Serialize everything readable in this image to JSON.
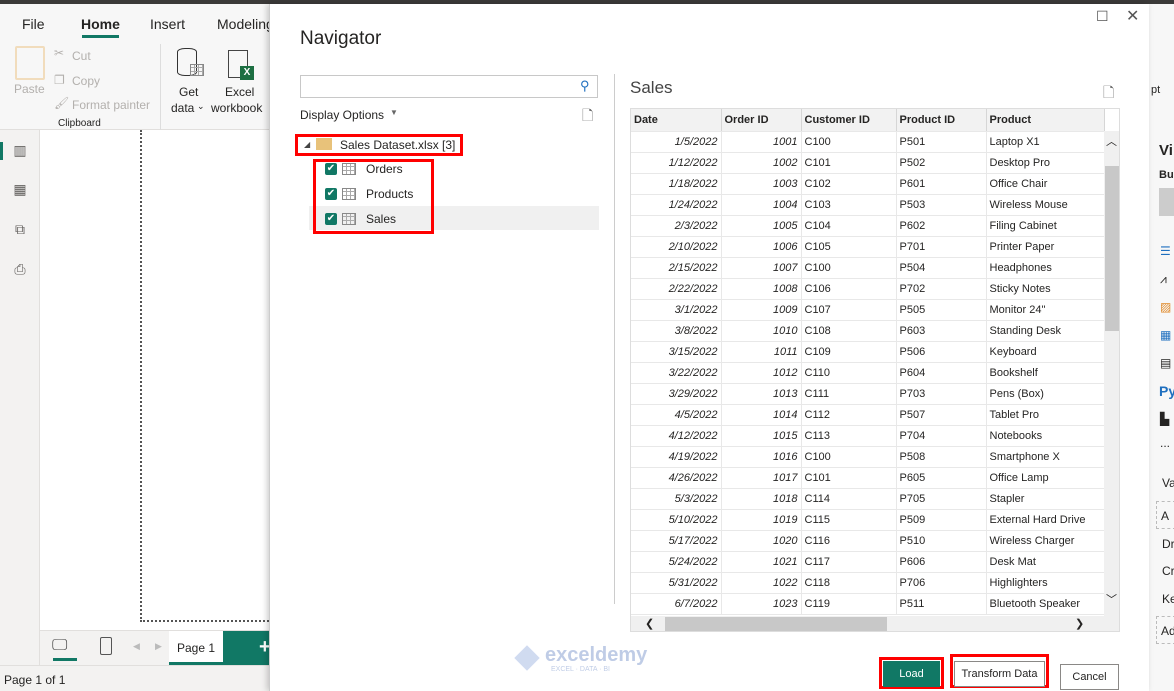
{
  "app": {
    "tabs": [
      "File",
      "Home",
      "Insert",
      "Modeling"
    ],
    "clipboard": {
      "paste": "Paste",
      "cut": "Cut",
      "copy": "Copy",
      "format_painter": "Format painter",
      "group": "Clipboard"
    },
    "get_data": [
      "Get",
      "data"
    ],
    "excel": [
      "Excel",
      "workbook"
    ],
    "page_tab": "Page 1",
    "status": "Page 1 of 1",
    "right_pane": {
      "title": "Vi",
      "build": "Bu",
      "py": "Py",
      "more": "...",
      "va": "Va",
      "a": "A",
      "dr": "Dr",
      "cr": "Cr",
      "ke": "Ke",
      "ad": "Ad",
      "pt": "pt"
    }
  },
  "navigator": {
    "title": "Navigator",
    "search_placeholder": "",
    "display_options": "Display Options",
    "file": "Sales Dataset.xlsx [3]",
    "items": [
      {
        "label": "Orders",
        "checked": true
      },
      {
        "label": "Products",
        "checked": true
      },
      {
        "label": "Sales",
        "checked": true
      }
    ],
    "preview_title": "Sales",
    "columns": [
      "Date",
      "Order ID",
      "Customer ID",
      "Product ID",
      "Product"
    ],
    "rows": [
      [
        "1/5/2022",
        "1001",
        "C100",
        "P501",
        "Laptop X1"
      ],
      [
        "1/12/2022",
        "1002",
        "C101",
        "P502",
        "Desktop Pro"
      ],
      [
        "1/18/2022",
        "1003",
        "C102",
        "P601",
        "Office Chair"
      ],
      [
        "1/24/2022",
        "1004",
        "C103",
        "P503",
        "Wireless Mouse"
      ],
      [
        "2/3/2022",
        "1005",
        "C104",
        "P602",
        "Filing Cabinet"
      ],
      [
        "2/10/2022",
        "1006",
        "C105",
        "P701",
        "Printer Paper"
      ],
      [
        "2/15/2022",
        "1007",
        "C100",
        "P504",
        "Headphones"
      ],
      [
        "2/22/2022",
        "1008",
        "C106",
        "P702",
        "Sticky Notes"
      ],
      [
        "3/1/2022",
        "1009",
        "C107",
        "P505",
        "Monitor 24\""
      ],
      [
        "3/8/2022",
        "1010",
        "C108",
        "P603",
        "Standing Desk"
      ],
      [
        "3/15/2022",
        "1011",
        "C109",
        "P506",
        "Keyboard"
      ],
      [
        "3/22/2022",
        "1012",
        "C110",
        "P604",
        "Bookshelf"
      ],
      [
        "3/29/2022",
        "1013",
        "C111",
        "P703",
        "Pens (Box)"
      ],
      [
        "4/5/2022",
        "1014",
        "C112",
        "P507",
        "Tablet Pro"
      ],
      [
        "4/12/2022",
        "1015",
        "C113",
        "P704",
        "Notebooks"
      ],
      [
        "4/19/2022",
        "1016",
        "C100",
        "P508",
        "Smartphone X"
      ],
      [
        "4/26/2022",
        "1017",
        "C101",
        "P605",
        "Office Lamp"
      ],
      [
        "5/3/2022",
        "1018",
        "C114",
        "P705",
        "Stapler"
      ],
      [
        "5/10/2022",
        "1019",
        "C115",
        "P509",
        "External Hard Drive"
      ],
      [
        "5/17/2022",
        "1020",
        "C116",
        "P510",
        "Wireless Charger"
      ],
      [
        "5/24/2022",
        "1021",
        "C117",
        "P606",
        "Desk Mat"
      ],
      [
        "5/31/2022",
        "1022",
        "C118",
        "P706",
        "Highlighters"
      ],
      [
        "6/7/2022",
        "1023",
        "C119",
        "P511",
        "Bluetooth Speaker"
      ]
    ],
    "buttons": {
      "load": "Load",
      "transform": "Transform Data",
      "cancel": "Cancel"
    }
  },
  "watermark": {
    "name": "exceldemy",
    "tag": "EXCEL · DATA · BI"
  },
  "colors": {
    "accent": "#117865",
    "highlight": "#ff0000"
  }
}
